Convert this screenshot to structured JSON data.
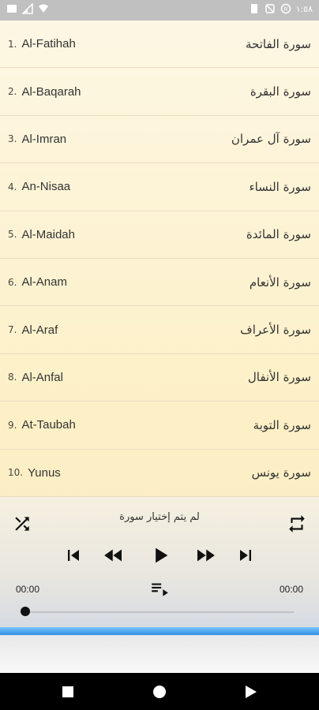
{
  "status_bar": {
    "time": "١:٥٨",
    "left_icons": [
      "image-icon",
      "signal-off-icon",
      "wifi-icon"
    ],
    "right_icons": [
      "battery-icon",
      "mute-icon",
      "data-saver-icon"
    ]
  },
  "surahs": [
    {
      "num": "1.",
      "en": "Al-Fatihah",
      "ar": "سورة الفاتحة"
    },
    {
      "num": "2.",
      "en": "Al-Baqarah",
      "ar": "سورة البقرة"
    },
    {
      "num": "3.",
      "en": "Al-Imran",
      "ar": "سورة آل عمران"
    },
    {
      "num": "4.",
      "en": "An-Nisaa",
      "ar": "سورة النساء"
    },
    {
      "num": "5.",
      "en": "Al-Maidah",
      "ar": "سورة المائدة"
    },
    {
      "num": "6.",
      "en": "Al-Anam",
      "ar": "سورة الأنعام"
    },
    {
      "num": "7.",
      "en": "Al-Araf",
      "ar": "سورة الأعراف"
    },
    {
      "num": "8.",
      "en": "Al-Anfal",
      "ar": "سورة الأنفال"
    },
    {
      "num": "9.",
      "en": "At-Taubah",
      "ar": "سورة التوبة"
    },
    {
      "num": "10.",
      "en": "Yunus",
      "ar": "سورة يونس"
    }
  ],
  "player": {
    "status": "لم يتم إختيار سورة",
    "time_left": "00:00",
    "time_right": "00:00",
    "progress": 0
  },
  "colors": {
    "accent_blue": "#2f8fe0",
    "list_bg": "#fdf0c6"
  }
}
